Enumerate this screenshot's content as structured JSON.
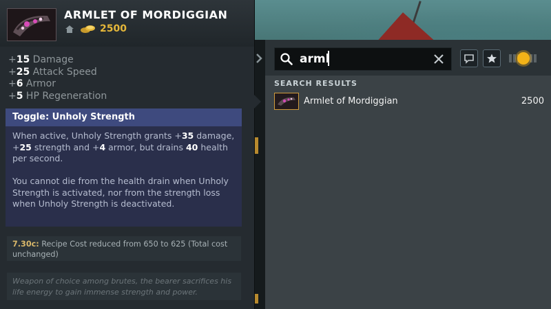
{
  "item": {
    "name": "ARMLET OF MORDIGGIAN",
    "cost": "2500",
    "icon": "armlet-icon",
    "stats": [
      {
        "plus": "+",
        "value": "15",
        "label": " Damage"
      },
      {
        "plus": "+",
        "value": "25",
        "label": " Attack Speed"
      },
      {
        "plus": "+",
        "value": "6",
        "label": " Armor"
      },
      {
        "plus": "+",
        "value": "5",
        "label": " HP Regeneration"
      }
    ],
    "ability": {
      "title": "Toggle: Unholy Strength",
      "desc_parts": [
        "When active, Unholy Strength grants +",
        "35",
        " damage, +",
        "25",
        " strength and +",
        "4",
        " armor, but drains ",
        "40",
        " health per second."
      ],
      "note": "You cannot die from the health drain when Unholy Strength is activated, nor from the strength loss when Unholy Strength is deactivated."
    },
    "patch": {
      "version": "7.30c:",
      "text": " Recipe Cost reduced from 650 to 625 (Total cost unchanged)"
    },
    "lore": "Weapon of choice among brutes, the bearer sacrifices his life energy to gain immense strength and power."
  },
  "shop": {
    "search_value": "arml",
    "results_heading": "SEARCH RESULTS",
    "results": [
      {
        "name": "Armlet of Mordiggian",
        "cost": "2500"
      }
    ]
  },
  "colors": {
    "gold": "#e5b73a",
    "ability_header": "#3e4a7e",
    "toggle_knob": "#f3b318"
  }
}
